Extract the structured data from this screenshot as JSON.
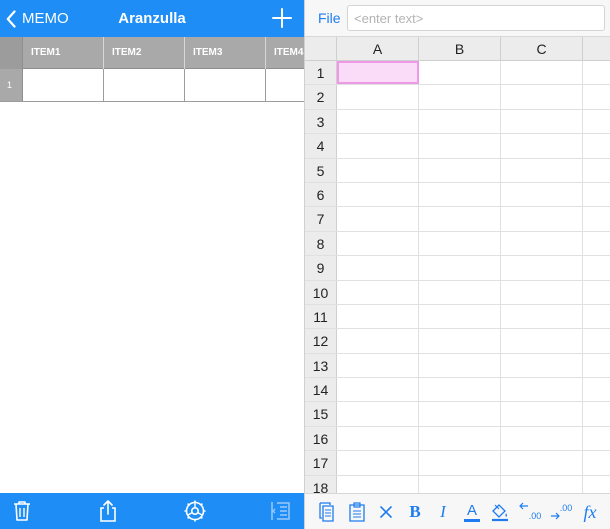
{
  "memo_pane": {
    "nav": {
      "back_label": "MEMO",
      "title": "Aranzulla"
    },
    "table": {
      "columns": [
        "ITEM1",
        "ITEM2",
        "ITEM3",
        "ITEM4"
      ],
      "rows": [
        {
          "index": "1",
          "cells": [
            "",
            "",
            "",
            ""
          ]
        }
      ]
    },
    "toolbar_icons": [
      "trash-icon",
      "share-icon",
      "gear-icon",
      "sidebar-toggle-icon"
    ]
  },
  "sheet_pane": {
    "file_label": "File",
    "formula_placeholder": "<enter text>",
    "formula_value": "",
    "columns": [
      "A",
      "B",
      "C"
    ],
    "row_numbers": [
      "1",
      "2",
      "3",
      "4",
      "5",
      "6",
      "7",
      "8",
      "9",
      "10",
      "11",
      "12",
      "13",
      "14",
      "15",
      "16",
      "17",
      "18"
    ],
    "selected_cell": "A1",
    "toolbar": {
      "bold_label": "B",
      "italic_label": "I",
      "text_color_label": "A",
      "fx_label": "fx",
      "decrease_decimal_label": ".00",
      "increase_decimal_label": ".00"
    }
  },
  "colors": {
    "accent_blue": "#1e8ef6",
    "header_gray": "#a9a9a9",
    "selection_fill": "#fbdcf8",
    "selection_border": "#ee99e6",
    "toolbar_icon": "#1e7cf0"
  }
}
